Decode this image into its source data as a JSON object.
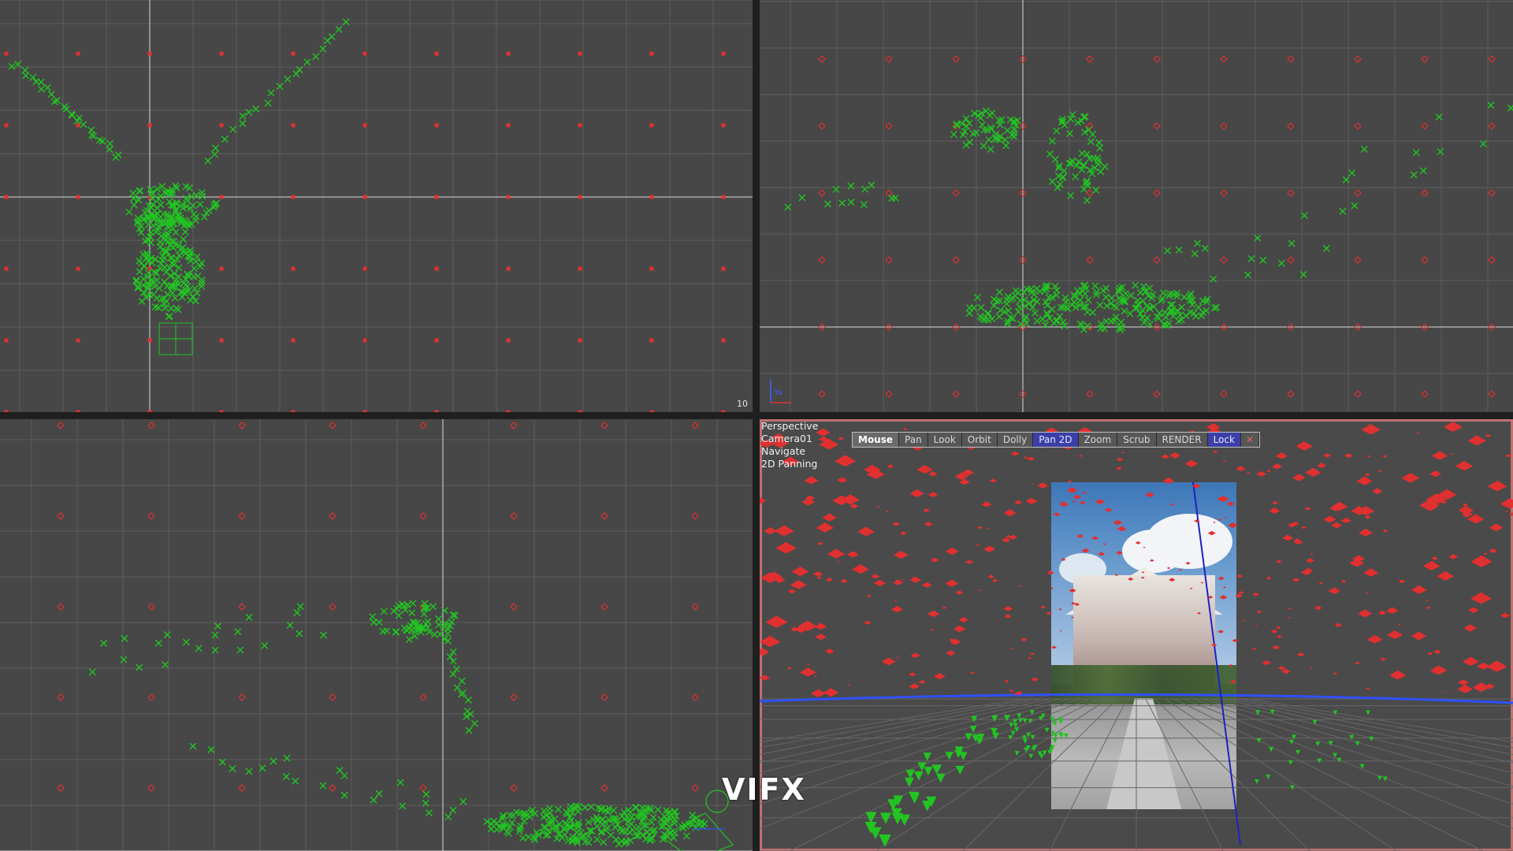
{
  "viewports": {
    "top": {
      "corner_number": "10"
    },
    "front": {
      "axis_label": "Ya"
    },
    "perspective": {
      "hud_lines": [
        "Perspective",
        "Camera01",
        "Navigate",
        "2D Panning"
      ],
      "toolbar": [
        {
          "label": "Mouse",
          "state": "label"
        },
        {
          "label": "Pan",
          "state": "normal"
        },
        {
          "label": "Look",
          "state": "normal"
        },
        {
          "label": "Orbit",
          "state": "normal"
        },
        {
          "label": "Dolly",
          "state": "normal"
        },
        {
          "label": "Pan 2D",
          "state": "active"
        },
        {
          "label": "Zoom",
          "state": "normal"
        },
        {
          "label": "Scrub",
          "state": "normal"
        },
        {
          "label": "RENDER",
          "state": "normal"
        },
        {
          "label": "Lock",
          "state": "active"
        },
        {
          "label": "✕",
          "state": "close"
        }
      ]
    }
  },
  "watermark": "VIFX",
  "colors": {
    "grid_line": "#5e5e5e",
    "axis_line": "#d8d8d8",
    "track_point": "#22c422",
    "locator_red": "#e03030",
    "toolbar_active": "#3b3fa8",
    "horizon_blue": "#3050ff"
  }
}
